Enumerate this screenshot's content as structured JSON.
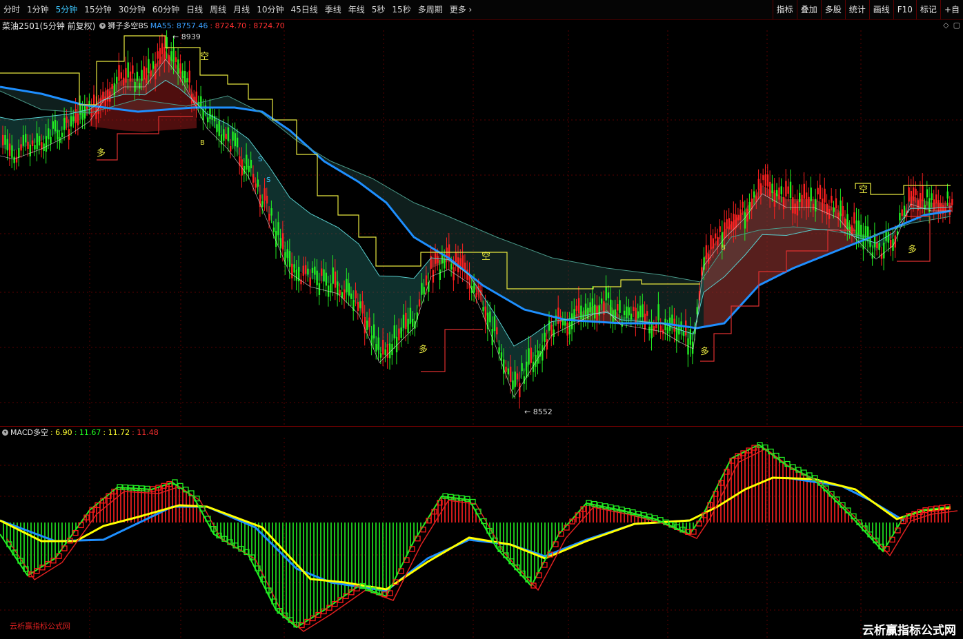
{
  "toolbar": {
    "periods": [
      "分时",
      "1分钟",
      "5分钟",
      "15分钟",
      "30分钟",
      "60分钟",
      "日线",
      "周线",
      "月线",
      "10分钟",
      "45日线",
      "季线",
      "年线",
      "5秒",
      "15秒",
      "多周期",
      "更多"
    ],
    "active_index": 2,
    "right_buttons": [
      "指标",
      "叠加",
      "多股",
      "统计",
      "画线",
      "F10",
      "标记",
      "+自"
    ]
  },
  "main_info": {
    "symbol": "菜油2501(5分钟 前复权)",
    "indicator": "狮子多空BS",
    "ma_label": "MA55: 8757.46",
    "v2": ": 8724.70",
    "v3": ": 8724.70"
  },
  "macd_info": {
    "name": "MACD多空",
    "v1": ": 6.90",
    "v2": ": 11.67",
    "v3": ": 11.72",
    "v4": ": 11.48"
  },
  "annotations": {
    "high_label": "8939",
    "low_label": "8552",
    "kong": "空",
    "duo": "多",
    "buy": "B",
    "sell": "S"
  },
  "colors": {
    "up": "#ff2020",
    "down": "#22ee22",
    "ma55": "#1e8fff",
    "yellow": "#ffff00",
    "grid": "#5a0000"
  },
  "watermark": {
    "left": "云析赢指标公式网",
    "right": "云析赢指标公式网"
  }
}
